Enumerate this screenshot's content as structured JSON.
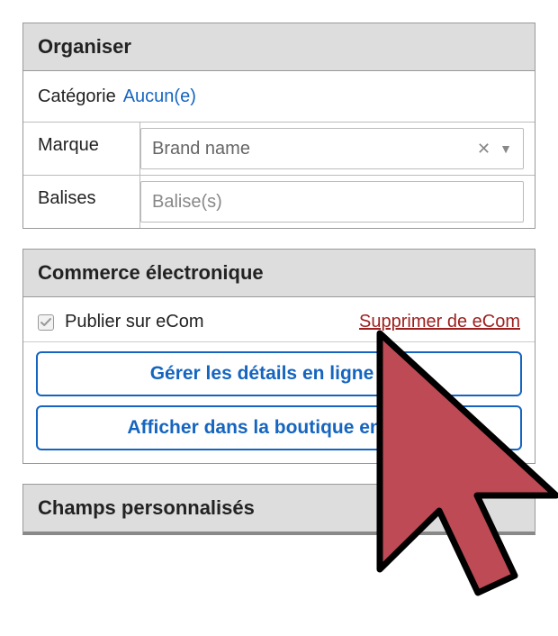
{
  "organize": {
    "title": "Organiser",
    "category_label": "Catégorie",
    "category_value": "Aucun(e)",
    "brand_label": "Marque",
    "brand_value": "Brand name",
    "tags_label": "Balises",
    "tags_placeholder": "Balise(s)"
  },
  "ecom": {
    "title": "Commerce électronique",
    "publish_label": "Publier sur eCom",
    "delete_label": "Supprimer de eCom",
    "manage_btn": "Gérer les détails en ligne",
    "view_btn": "Afficher dans la boutique en ligne"
  },
  "custom_fields": {
    "title": "Champs personnalisés"
  }
}
